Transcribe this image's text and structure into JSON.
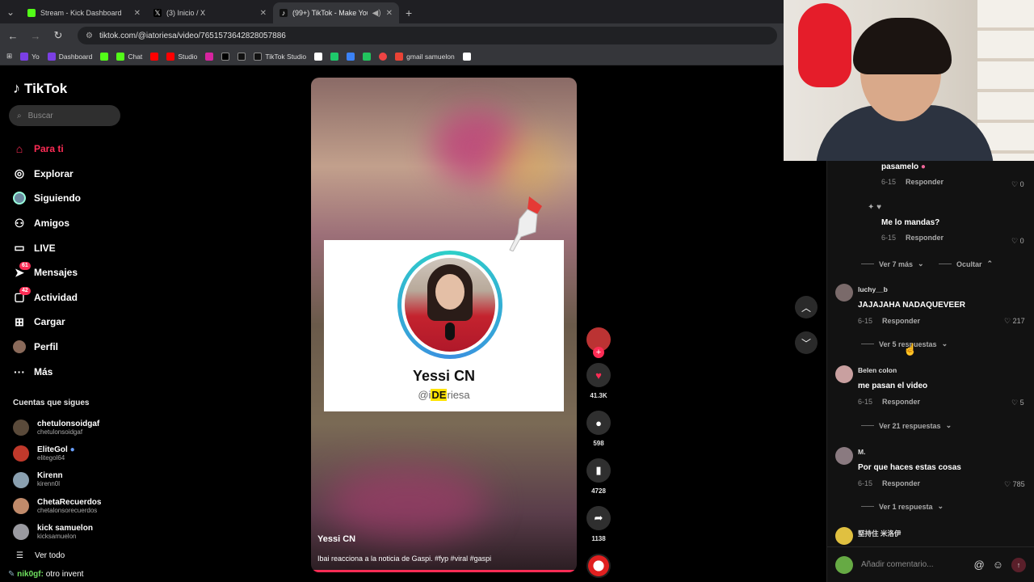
{
  "browser": {
    "tabs": [
      {
        "label": "Stream - Kick Dashboard",
        "color": "#53fc18"
      },
      {
        "label": "(3) Inicio / X",
        "color": "#ffffff"
      },
      {
        "label": "(99+) TikTok - Make Your Da",
        "color": "#ffffff",
        "active": true
      }
    ],
    "url": "tiktok.com/@iatoriesa/video/7651573642828057886",
    "bookmarks": [
      "Yo",
      "Dashboard",
      "",
      "Chat",
      "",
      "Studio",
      "",
      "",
      "",
      "TikTok Studio",
      "",
      "",
      "",
      "",
      "",
      "gmail samuelon",
      ""
    ]
  },
  "sidebar": {
    "logo": "TikTok",
    "search_placeholder": "Buscar",
    "menu": [
      {
        "label": "Para ti",
        "icon": "home-icon",
        "glyph": "⌂"
      },
      {
        "label": "Explorar",
        "icon": "compass-icon",
        "glyph": "◎"
      },
      {
        "label": "Siguiendo",
        "icon": "following-icon",
        "glyph": "●"
      },
      {
        "label": "Amigos",
        "icon": "friends-icon",
        "glyph": "👥"
      },
      {
        "label": "LIVE",
        "icon": "live-icon",
        "glyph": "▭"
      },
      {
        "label": "Mensajes",
        "icon": "messages-icon",
        "glyph": "✈",
        "badge": "61"
      },
      {
        "label": "Actividad",
        "icon": "activity-icon",
        "glyph": "▢",
        "badge": "42"
      },
      {
        "label": "Cargar",
        "icon": "upload-icon",
        "glyph": "⊞"
      },
      {
        "label": "Perfil",
        "icon": "profile-icon",
        "glyph": "●"
      },
      {
        "label": "Más",
        "icon": "more-icon",
        "glyph": "···"
      }
    ],
    "following_header": "Cuentas que sigues",
    "following": [
      {
        "name": "chetulonsoidgaf",
        "handle": "chetulonsoidgaf"
      },
      {
        "name": "EliteGol",
        "handle": "elitegol64"
      },
      {
        "name": "Kirenn",
        "handle": "kirenn0l"
      },
      {
        "name": "ChetaRecuerdos",
        "handle": "chetalonsorecuerdos"
      },
      {
        "name": "kick samuelon",
        "handle": "kicksamuelon"
      }
    ],
    "see_all": "Ver todo",
    "chat_user": "nik0gf:",
    "chat_msg": "otro invent"
  },
  "video": {
    "card_name": "Yessi CN",
    "handle_pre": "@i",
    "handle_hl": "DE",
    "handle_post": "riesa",
    "author": "Yessi CN",
    "caption": "Ibai reacciona a la noticia de Gaspi. #fyp #viral #gaspi"
  },
  "actions": {
    "likes": "41.3K",
    "comments": "598",
    "saves": "4728",
    "shares": "1138"
  },
  "comments": {
    "c1_text": "pasamelo",
    "c1_date": "6-15",
    "reply": "Responder",
    "c1_likes": "0",
    "c2_text": "Me lo mandas?",
    "c2_date": "6-15",
    "c2_likes": "0",
    "view_more_7": "Ver 7 más",
    "hide": "Ocultar",
    "c3_name": "luchy__b",
    "c3_text": "JAJAJAHA NADAQUEVEER",
    "c3_date": "6-15",
    "c3_likes": "217",
    "view_5": "Ver 5 respuestas",
    "c4_name": "Belen colon",
    "c4_text": "me pasan el video",
    "c4_date": "6-15",
    "c4_likes": "5",
    "view_21": "Ver 21 respuestas",
    "c5_name": "M.",
    "c5_text": "Por que haces estas cosas",
    "c5_date": "6-15",
    "c5_likes": "785",
    "view_1": "Ver 1 respuesta",
    "c6_name": "堅持住 米洛伊",
    "composer_placeholder": "Añadir comentario..."
  }
}
